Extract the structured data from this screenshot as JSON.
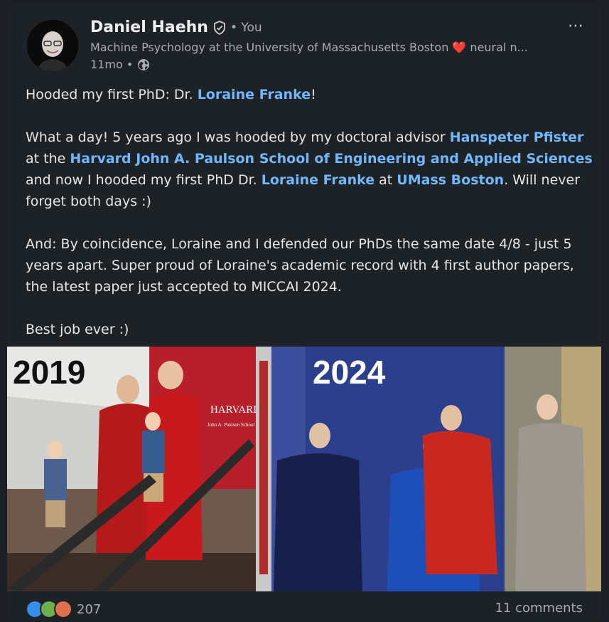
{
  "author": {
    "name": "Daniel Haehn",
    "you_label": "• You",
    "headline": "Machine Psychology at the University of Massachusetts Boston ❤️ neural n...",
    "time": "11mo •"
  },
  "menu_icon": "⋯",
  "post": {
    "line1": {
      "pre": "Hooded my first PhD: Dr. ",
      "link": "Loraine Franke",
      "post": "!"
    },
    "para2": {
      "t1": "What a day! 5 years ago I was hooded by my doctoral advisor ",
      "l1": "Hanspeter Pfister",
      "t2": " at the ",
      "l2": "Harvard John A. Paulson School of Engineering and Applied Sciences",
      "t3": " and now I hooded my first PhD Dr. ",
      "l3": "Loraine Franke",
      "t4": " at ",
      "l4": "UMass Boston",
      "t5": ". Will never forget both days :)"
    },
    "para3": "And: By coincidence, Loraine and I defended our PhDs the same date 4/8 - just 5 years apart. Super proud of Loraine's academic record with 4 first author papers, the latest paper just accepted to MICCAI 2024.",
    "para4": "Best job ever :)"
  },
  "photo": {
    "left_year": "2019",
    "right_year": "2024",
    "sign_text": "HARVARD",
    "sign_sub": "John A. Paulson School of Engineering and Applied Sciences"
  },
  "social": {
    "reaction_count": "207",
    "comments": "11 comments"
  },
  "colors": {
    "link": "#71b7fb",
    "background": "#1d2226"
  }
}
